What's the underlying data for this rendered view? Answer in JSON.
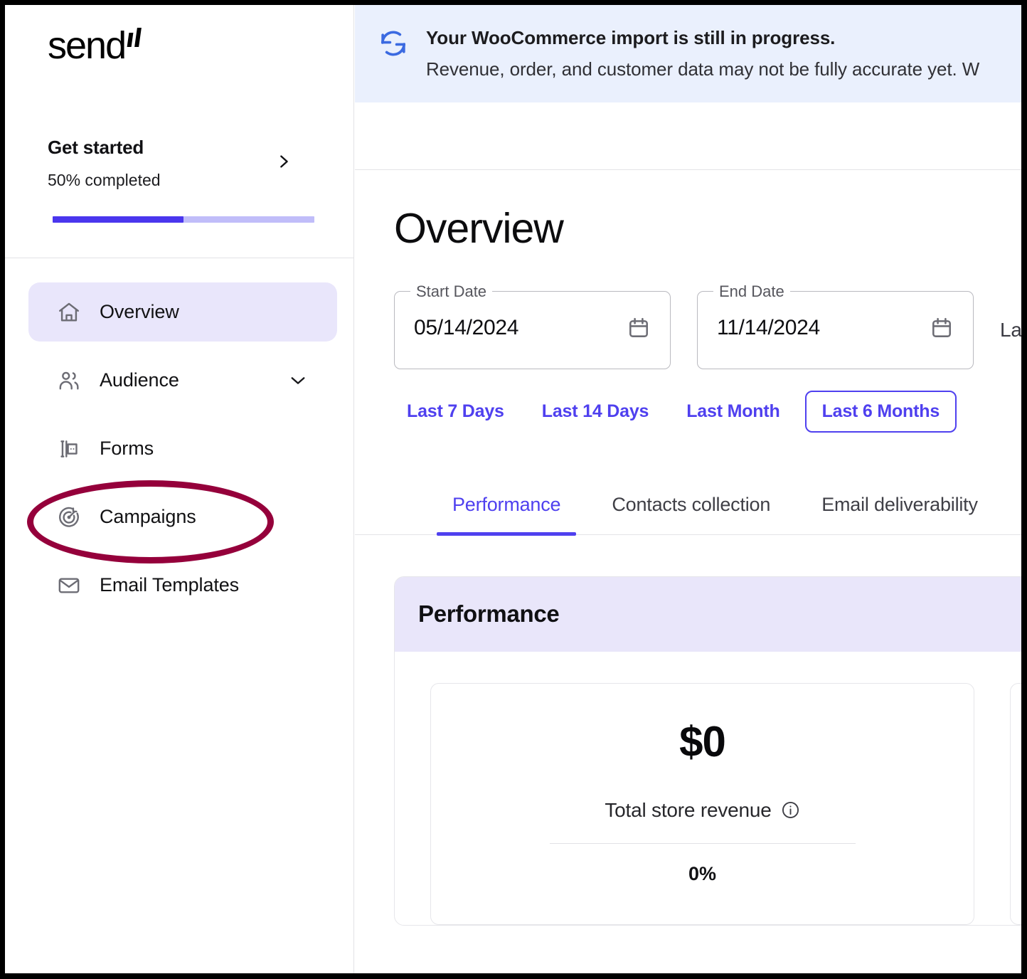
{
  "brand": {
    "logo_text": "send"
  },
  "sidebar": {
    "get_started": {
      "title": "Get started",
      "subtitle": "50% completed",
      "progress_percent": 50
    },
    "items": [
      {
        "label": "Overview",
        "icon": "home-icon",
        "active": true,
        "expandable": false
      },
      {
        "label": "Audience",
        "icon": "users-icon",
        "active": false,
        "expandable": true
      },
      {
        "label": "Forms",
        "icon": "form-icon",
        "active": false,
        "expandable": false
      },
      {
        "label": "Campaigns",
        "icon": "target-icon",
        "active": false,
        "expandable": false
      },
      {
        "label": "Email Templates",
        "icon": "envelope-icon",
        "active": false,
        "expandable": false
      }
    ]
  },
  "banner": {
    "icon": "sync-refresh-icon",
    "line1": "Your WooCommerce import is still in progress.",
    "line2": "Revenue, order, and customer data may not be fully accurate yet. W"
  },
  "page": {
    "title": "Overview"
  },
  "date_range": {
    "start": {
      "legend": "Start Date",
      "value": "05/14/2024",
      "icon": "calendar-icon"
    },
    "end": {
      "legend": "End Date",
      "value": "11/14/2024",
      "icon": "calendar-icon"
    },
    "trailing_text": "Las",
    "quick_ranges": [
      {
        "label": "Last 7 Days",
        "selected": false
      },
      {
        "label": "Last 14 Days",
        "selected": false
      },
      {
        "label": "Last Month",
        "selected": false
      },
      {
        "label": "Last 6 Months",
        "selected": true
      }
    ]
  },
  "tabs": [
    {
      "label": "Performance",
      "active": true
    },
    {
      "label": "Contacts collection",
      "active": false
    },
    {
      "label": "Email deliverability",
      "active": false
    }
  ],
  "performance_card": {
    "title": "Performance",
    "stats": [
      {
        "value": "$0",
        "label": "Total store revenue",
        "info_icon": "info-icon",
        "delta": "0%"
      }
    ]
  },
  "colors": {
    "accent": "#4f40ef",
    "accent_soft": "#e9e6fa",
    "banner_bg": "#eaf0fd",
    "banner_icon": "#3b6ae1",
    "annotation": "#95003b",
    "progress_track": "#c0bdf9"
  }
}
